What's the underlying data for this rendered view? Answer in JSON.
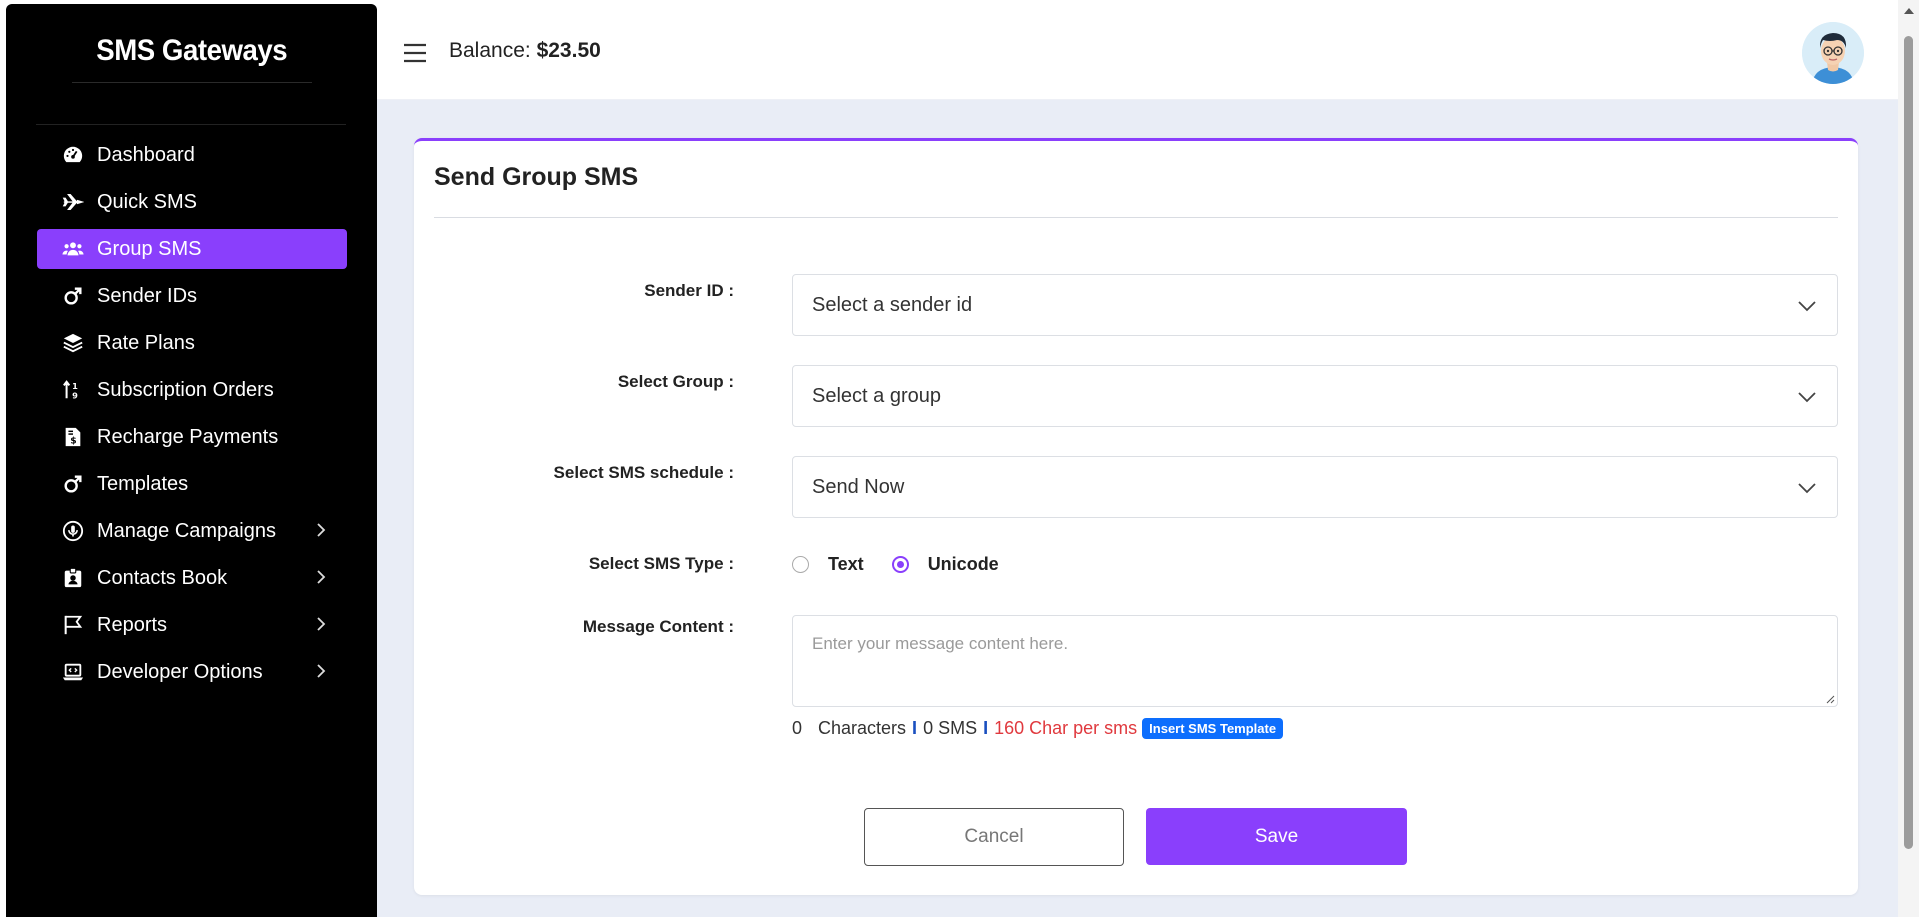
{
  "sidebar": {
    "brand": "SMS Gateways",
    "items": [
      {
        "label": "Dashboard",
        "icon": "gauge-icon"
      },
      {
        "label": "Quick SMS",
        "icon": "plane-icon"
      },
      {
        "label": "Group SMS",
        "icon": "users-icon",
        "active": true
      },
      {
        "label": "Sender IDs",
        "icon": "mars-icon"
      },
      {
        "label": "Rate Plans",
        "icon": "layers-icon"
      },
      {
        "label": "Subscription Orders",
        "icon": "sort-icon"
      },
      {
        "label": "Recharge Payments",
        "icon": "invoice-dollar-icon"
      },
      {
        "label": "Templates",
        "icon": "mars-icon"
      },
      {
        "label": "Manage Campaigns",
        "icon": "circle-mic-icon",
        "has_children": true
      },
      {
        "label": "Contacts Book",
        "icon": "id-badge-icon",
        "has_children": true
      },
      {
        "label": "Reports",
        "icon": "flag-icon",
        "has_children": true
      },
      {
        "label": "Developer Options",
        "icon": "laptop-code-icon",
        "has_children": true
      }
    ]
  },
  "topbar": {
    "balance_label": "Balance:",
    "balance_value": "$23.50"
  },
  "form": {
    "title": "Send Group SMS",
    "sender": {
      "label": "Sender ID :",
      "value": "Select a sender id"
    },
    "group": {
      "label": "Select Group :",
      "value": "Select a group"
    },
    "schedule": {
      "label": "Select SMS schedule :",
      "value": "Send Now"
    },
    "sms_type": {
      "label": "Select SMS Type :",
      "options": [
        {
          "label": "Text",
          "checked": false
        },
        {
          "label": "Unicode",
          "checked": true
        }
      ]
    },
    "message": {
      "label": "Message Content :",
      "placeholder": "Enter your message content here."
    },
    "counter": {
      "chars": "0",
      "chars_label": "Characters",
      "sep": "I",
      "sms": "0 SMS",
      "per_sms": "160 Char per sms",
      "template_button": "Insert SMS Template"
    },
    "cancel_label": "Cancel",
    "save_label": "Save"
  },
  "colors": {
    "accent": "#8a3ffc",
    "sidebar_bg": "#000000",
    "content_bg": "#e9edf6",
    "template_button": "#0d6efd",
    "per_sms_text": "#e0393e"
  }
}
